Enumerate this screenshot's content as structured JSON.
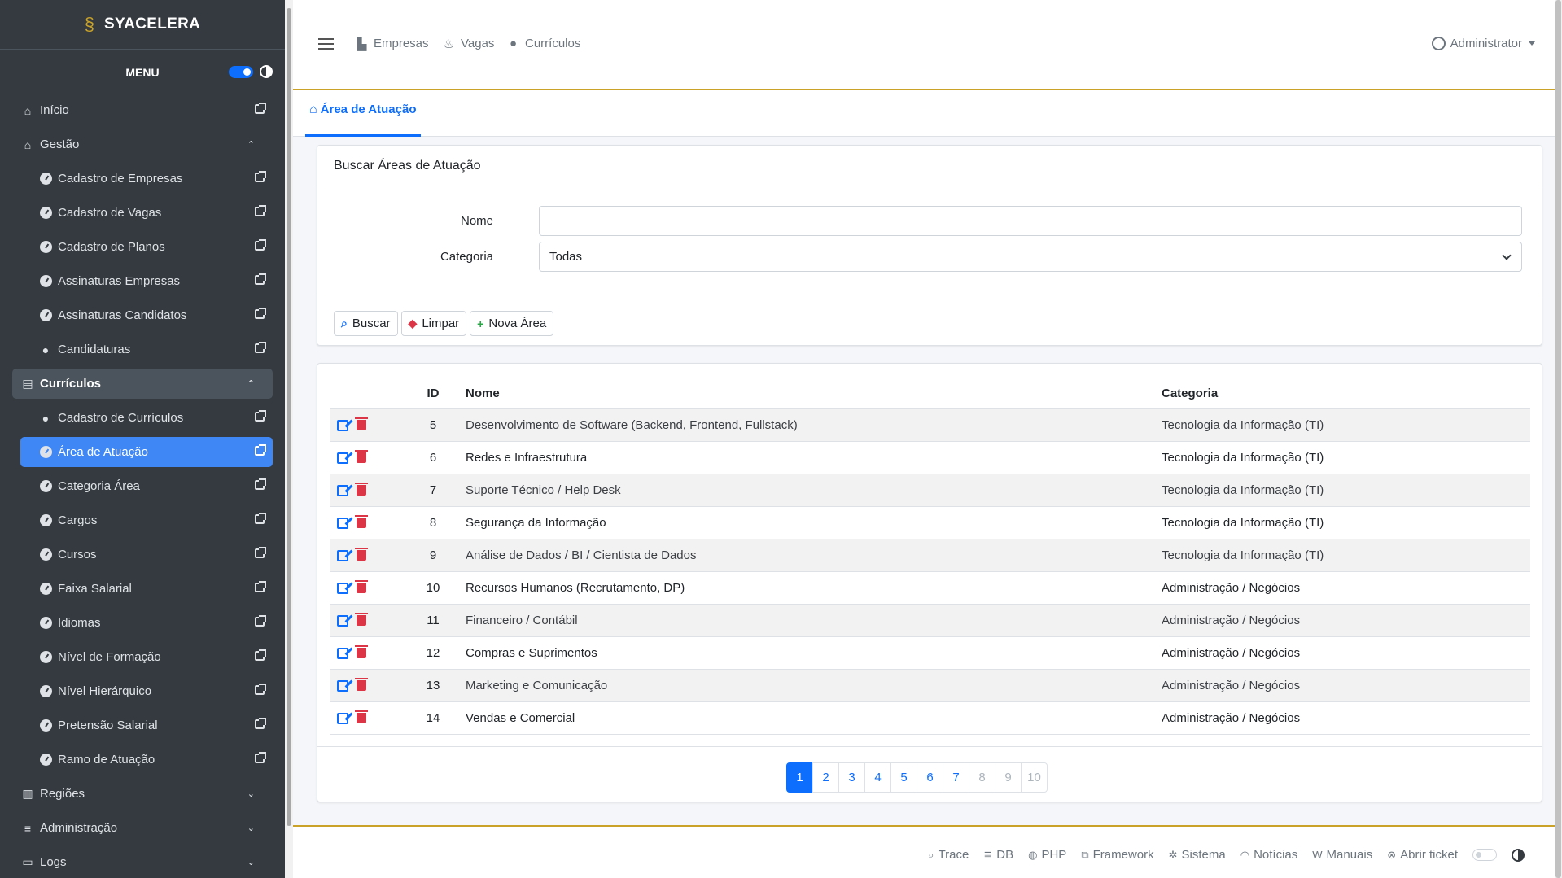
{
  "brand": {
    "name": "SYACELERA"
  },
  "sidebar": {
    "menu_label": "MENU",
    "items": [
      {
        "label": "Início",
        "type": "link"
      },
      {
        "label": "Gestão",
        "type": "group"
      },
      {
        "label": "Cadastro de Empresas",
        "type": "sub"
      },
      {
        "label": "Cadastro de Vagas",
        "type": "sub"
      },
      {
        "label": "Cadastro de Planos",
        "type": "sub"
      },
      {
        "label": "Assinaturas Empresas",
        "type": "sub"
      },
      {
        "label": "Assinaturas Candidatos",
        "type": "sub"
      },
      {
        "label": "Candidaturas",
        "type": "sub"
      },
      {
        "label": "Currículos",
        "type": "group-open"
      },
      {
        "label": "Cadastro de Currículos",
        "type": "sub"
      },
      {
        "label": "Área de Atuação",
        "type": "sub-active"
      },
      {
        "label": "Categoria Área",
        "type": "sub"
      },
      {
        "label": "Cargos",
        "type": "sub"
      },
      {
        "label": "Cursos",
        "type": "sub"
      },
      {
        "label": "Faixa Salarial",
        "type": "sub"
      },
      {
        "label": "Idiomas",
        "type": "sub"
      },
      {
        "label": "Nível de Formação",
        "type": "sub"
      },
      {
        "label": "Nível Hierárquico",
        "type": "sub"
      },
      {
        "label": "Pretensão Salarial",
        "type": "sub"
      },
      {
        "label": "Ramo de Atuação",
        "type": "sub"
      },
      {
        "label": "Regiões",
        "type": "group-closed"
      },
      {
        "label": "Administração",
        "type": "group-closed"
      },
      {
        "label": "Logs",
        "type": "group-closed"
      }
    ]
  },
  "topbar": {
    "links": [
      {
        "label": "Empresas",
        "icon": "factory-icon"
      },
      {
        "label": "Vagas",
        "icon": "vagas-icon"
      },
      {
        "label": "Currículos",
        "icon": "user-tie-icon"
      }
    ],
    "user": "Administrator"
  },
  "tab": {
    "label": "Área de Atuação"
  },
  "search": {
    "title": "Buscar Áreas de Atuação",
    "name_label": "Nome",
    "name_value": "",
    "category_label": "Categoria",
    "category_value": "Todas",
    "buttons": {
      "search": "Buscar",
      "clear": "Limpar",
      "new": "Nova Área"
    }
  },
  "table": {
    "headers": {
      "id": "ID",
      "name": "Nome",
      "category": "Categoria"
    },
    "rows": [
      {
        "id": "5",
        "name": "Desenvolvimento de Software (Backend, Frontend, Fullstack)",
        "category": "Tecnologia da Informação (TI)"
      },
      {
        "id": "6",
        "name": "Redes e Infraestrutura",
        "category": "Tecnologia da Informação (TI)"
      },
      {
        "id": "7",
        "name": "Suporte Técnico / Help Desk",
        "category": "Tecnologia da Informação (TI)"
      },
      {
        "id": "8",
        "name": "Segurança da Informação",
        "category": "Tecnologia da Informação (TI)"
      },
      {
        "id": "9",
        "name": "Análise de Dados / BI / Cientista de Dados",
        "category": "Tecnologia da Informação (TI)"
      },
      {
        "id": "10",
        "name": "Recursos Humanos (Recrutamento, DP)",
        "category": "Administração / Negócios"
      },
      {
        "id": "11",
        "name": "Financeiro / Contábil",
        "category": "Administração / Negócios"
      },
      {
        "id": "12",
        "name": "Compras e Suprimentos",
        "category": "Administração / Negócios"
      },
      {
        "id": "13",
        "name": "Marketing e Comunicação",
        "category": "Administração / Negócios"
      },
      {
        "id": "14",
        "name": "Vendas e Comercial",
        "category": "Administração / Negócios"
      }
    ]
  },
  "pagination": {
    "pages": [
      "1",
      "2",
      "3",
      "4",
      "5",
      "6",
      "7",
      "8",
      "9",
      "10"
    ],
    "current": "1",
    "disabled": [
      "8",
      "9",
      "10"
    ]
  },
  "footer": {
    "links": [
      {
        "label": "Trace",
        "icon": "search-icon"
      },
      {
        "label": "DB",
        "icon": "database-icon"
      },
      {
        "label": "PHP",
        "icon": "php-icon"
      },
      {
        "label": "Framework",
        "icon": "sitemap-icon"
      },
      {
        "label": "Sistema",
        "icon": "gear-icon"
      },
      {
        "label": "Notícias",
        "icon": "rss-icon"
      },
      {
        "label": "Manuais",
        "icon": "wikipedia-icon"
      },
      {
        "label": "Abrir ticket",
        "icon": "lifebuoy-icon"
      }
    ]
  },
  "colors": {
    "sidebar_bg": "#343a40",
    "accent": "#0d6efd",
    "gold": "#c9a227",
    "danger": "#dc3545"
  }
}
